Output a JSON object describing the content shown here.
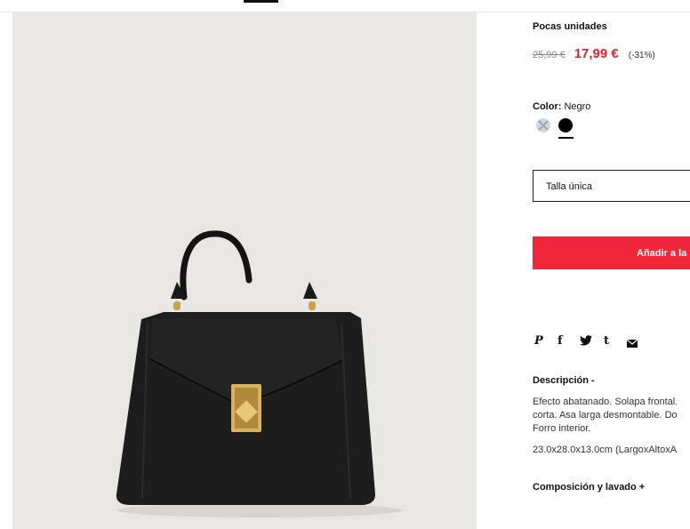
{
  "product": {
    "stock_label": "Pocas unidades",
    "old_price": "25,99 €",
    "new_price": "17,99 €",
    "discount": "(-31%)",
    "color_label": "Color:",
    "color_value": "Negro",
    "swatches": [
      "light-blue-unavailable",
      "black-selected"
    ],
    "size_label": "Talla única",
    "add_to_bag_label": "Añadir a la"
  },
  "share": {
    "icons": [
      "pinterest-icon",
      "facebook-icon",
      "twitter-icon",
      "tumblr-icon",
      "mail-icon"
    ],
    "pinterest": "P",
    "facebook": "f",
    "tumblr": "t"
  },
  "description": {
    "title": "Descripción -",
    "text": "Efecto abatanado. Solapa frontal.\ncorta. Asa larga desmontable. Do\nForro interior.",
    "dimensions": "23.0x28.0x13.0cm (LargoxAltoxA"
  },
  "composition": {
    "title": "Composición y lavado +"
  },
  "colors": {
    "accent": "#f0273a",
    "sale_price": "#e5202e",
    "image_background": "#e8e7e4"
  }
}
